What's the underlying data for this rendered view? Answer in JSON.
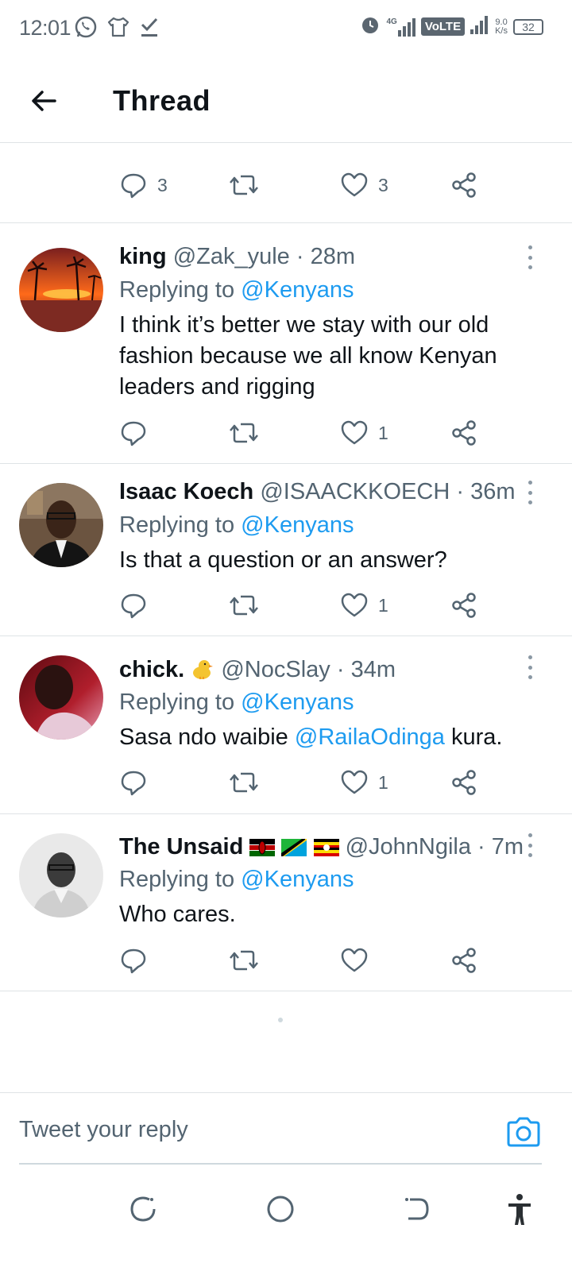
{
  "status_bar": {
    "time": "12:01",
    "network": "4G",
    "volte": "VoLTE",
    "speed_value": "9.0",
    "speed_unit": "K/s",
    "battery": "32"
  },
  "header": {
    "title": "Thread"
  },
  "top_actions": {
    "reply_count": "3",
    "like_count": "3"
  },
  "tweets": [
    {
      "name": "king",
      "handle": "@Zak_yule",
      "time": "28m",
      "replying_prefix": "Replying to",
      "replying_to": "@Kenyans",
      "text": "I think it’s better we stay with our old fashion because we all know Kenyan leaders and rigging",
      "like_count": "1"
    },
    {
      "name": "Isaac Koech",
      "handle": "@ISAACKKOECH",
      "time": "36m",
      "replying_prefix": "Replying to",
      "replying_to": "@Kenyans",
      "text": "Is that a question or an answer?",
      "like_count": "1"
    },
    {
      "name": "chick.",
      "handle": "@NocSlay",
      "time": "34m",
      "replying_prefix": "Replying to",
      "replying_to": "@Kenyans",
      "text_before": "Sasa ndo waibie",
      "mention": "@RailaOdinga",
      "text_after": "kura.",
      "like_count": "1"
    },
    {
      "name": "The Unsaid",
      "handle": "@JohnNgila",
      "time": "7m",
      "replying_prefix": "Replying to",
      "replying_to": "@Kenyans",
      "text": "Who cares.",
      "like_count": ""
    }
  ],
  "reply_bar": {
    "placeholder": "Tweet your reply"
  },
  "colors": {
    "accent": "#1d9bf0",
    "secondary_text": "#536471",
    "divider": "#dfe3e6"
  }
}
